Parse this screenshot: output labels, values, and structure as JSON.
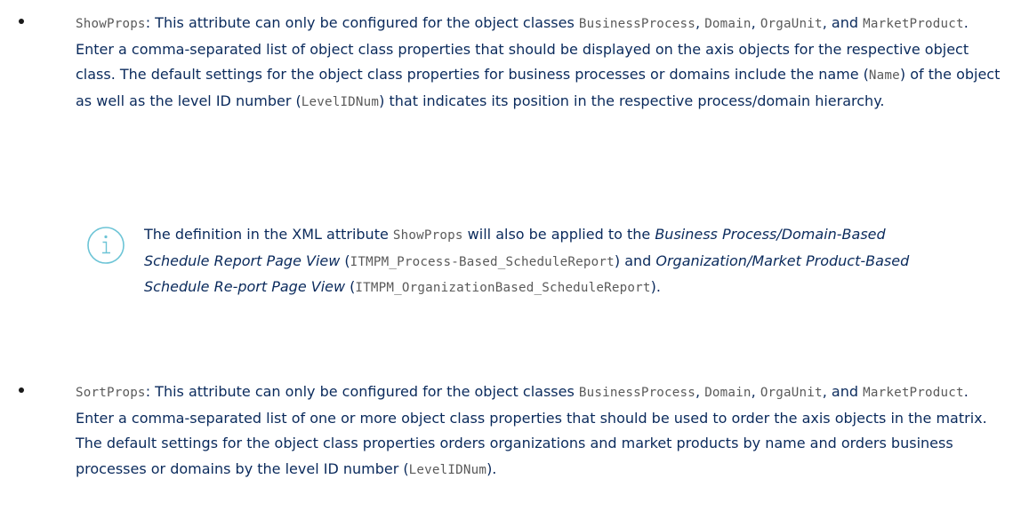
{
  "item1": {
    "code_showprops": "ShowProps",
    "t1": ": This attribute can only be configured for the object classes ",
    "code_bp": "BusinessProcess",
    "t2": ", ",
    "code_domain": "Domain",
    "t3": ", ",
    "code_orgaunit": "OrgaUnit",
    "t4": ", and ",
    "code_mp": "MarketProduct",
    "t5": ". Enter a comma-separated list of object class properties that should be displayed on the axis objects for the respective object class. The default settings for the object class properties for business processes or domains include the name (",
    "code_name": "Name",
    "t6": ") of the object as well as the level ID number (",
    "code_levelidnum": "LevelIDNum",
    "t7": ") that indicates its position in the respective process/domain hierarchy."
  },
  "note": {
    "icon": "info-icon",
    "t1": "The definition in the XML attribute ",
    "code_showprops": "ShowProps",
    "t2": " will also be applied to the ",
    "em1": "Business Process/Domain-Based Schedule Report Page View",
    "t3": " (",
    "code1": "ITMPM_Process-Based_ScheduleReport",
    "t4": ") and ",
    "em2": "Organization/Market Product-Based Schedule Re-port Page View",
    "t5": " (",
    "code2": "ITMPM_OrganizationBased_ScheduleReport",
    "t6": ")."
  },
  "item2": {
    "code_sortprops": "SortProps",
    "t1": ": This attribute can only be configured for the object classes ",
    "code_bp": "BusinessProcess",
    "t2": ", ",
    "code_domain": "Domain",
    "t3": ", ",
    "code_orgaunit": "OrgaUnit",
    "t4": ", and ",
    "code_mp": "MarketProduct",
    "t5": ". Enter a comma-separated list of one or more object class properties that should be used to order the axis objects in the matrix. The default settings for the object class properties orders organizations and market products by name and orders business processes or domains by the level ID number (",
    "code_levelidnum": "LevelIDNum",
    "t6": ")."
  },
  "colors": {
    "text": "#0a2a5c",
    "code": "#5a5a5a",
    "icon": "#6cc4d6",
    "bullet": "#1a1a1a"
  }
}
